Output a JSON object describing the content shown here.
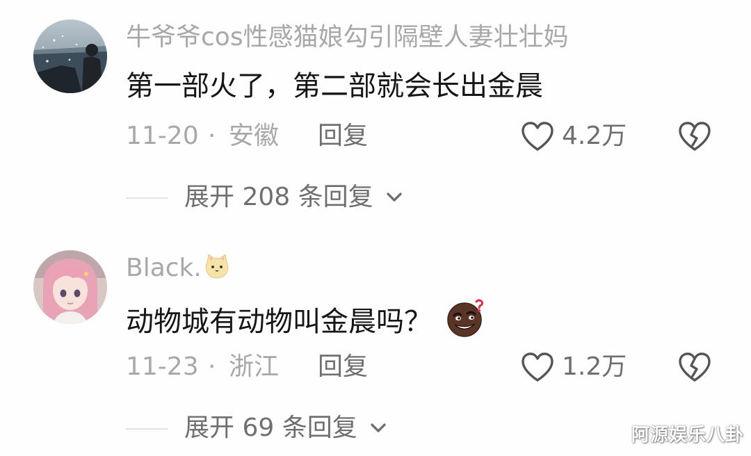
{
  "comments": [
    {
      "avatar": "seaside-photo-avatar",
      "username": "牛爷爷cos性感猫娘勾引隔壁人妻壮壮妈",
      "text": "第一部火了，第二部就会长出金晨",
      "date": "11-20",
      "separator": "·",
      "location": "安徽",
      "reply_label": "回复",
      "like_icon": "heart-outline-icon",
      "like_count": "4.2万",
      "dislike_icon": "broken-heart-icon",
      "expand_label": "展开 208 条回复"
    },
    {
      "avatar": "anime-girl-avatar",
      "username": "Black.",
      "username_emoji": "cat-face-emoji",
      "text": "动物城有动物叫金晨吗？",
      "text_emoji": "thinking-face-emoji",
      "date": "11-23",
      "separator": "·",
      "location": "浙江",
      "reply_label": "回复",
      "like_icon": "heart-outline-icon",
      "like_count": "1.2万",
      "dislike_icon": "broken-heart-icon",
      "expand_label": "展开 69 条回复"
    }
  ],
  "watermark": "阿源娱乐八卦",
  "colors": {
    "background": "#fefefe",
    "primary_text": "#161616",
    "secondary_text": "#a8a8a8",
    "action_text": "#6f6f6f",
    "divider": "#e3e3e3"
  }
}
